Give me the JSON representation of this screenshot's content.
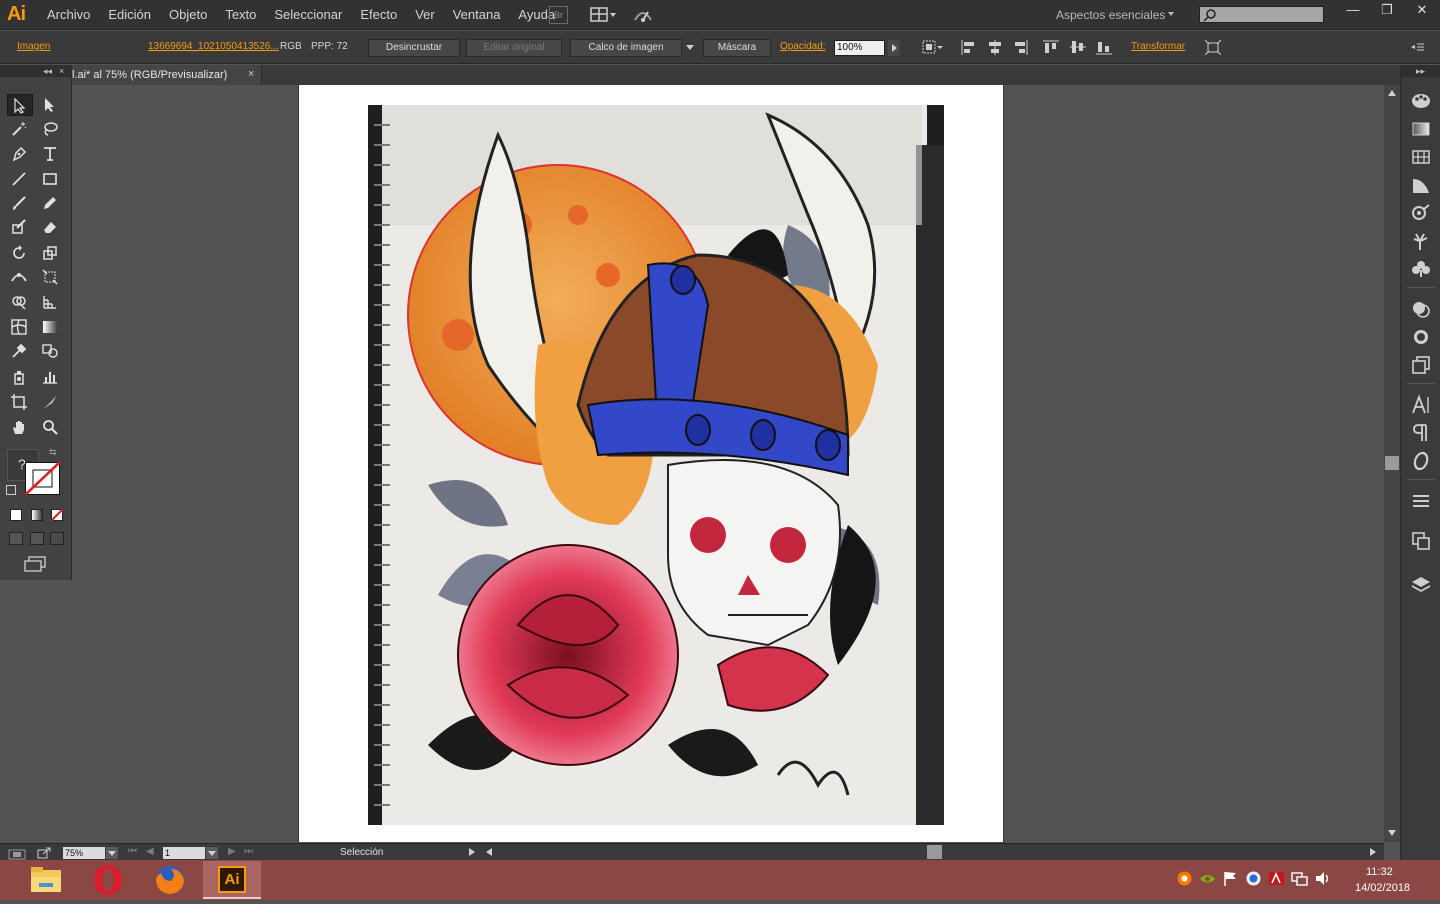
{
  "app": {
    "logo": "Ai"
  },
  "menu": {
    "items": [
      "Archivo",
      "Edición",
      "Objeto",
      "Texto",
      "Seleccionar",
      "Efecto",
      "Ver",
      "Ventana",
      "Ayuda"
    ],
    "bridge_label": "Br",
    "workspace": "Aspectos esenciales",
    "search_placeholder": ""
  },
  "window_controls": {
    "minimize": "—",
    "restore": "❐",
    "close": "✕"
  },
  "control_bar": {
    "object_type": "Imagen",
    "file_link": "13669694_1021050413526...",
    "color_mode": "RGB",
    "ppi": "PPP: 72",
    "unembed": "Desincrustar",
    "edit_original": "Editar original",
    "image_trace": "Calco de imagen",
    "mask": "Máscara",
    "opacity_label": "Opacidad:",
    "opacity_value": "100%",
    "transform": "Transformar"
  },
  "document": {
    "tab_title": "l.ai* al 75% (RGB/Previsualizar)",
    "close": "×"
  },
  "tools_panel": {
    "collapse": "◂◂",
    "close": "×"
  },
  "right_dock": {
    "collapse": "▸▸"
  },
  "status_bar": {
    "zoom": "75%",
    "page": "1",
    "status": "Selección"
  },
  "taskbar": {
    "apps": [
      "file-explorer",
      "opera",
      "firefox",
      "illustrator"
    ],
    "illustrator_label": "Ai",
    "time": "11:32",
    "date": "14/02/2018"
  },
  "colors": {
    "accent_orange": "#f39c12",
    "taskbar": "#8a4744",
    "panel": "#3a3a3a"
  }
}
